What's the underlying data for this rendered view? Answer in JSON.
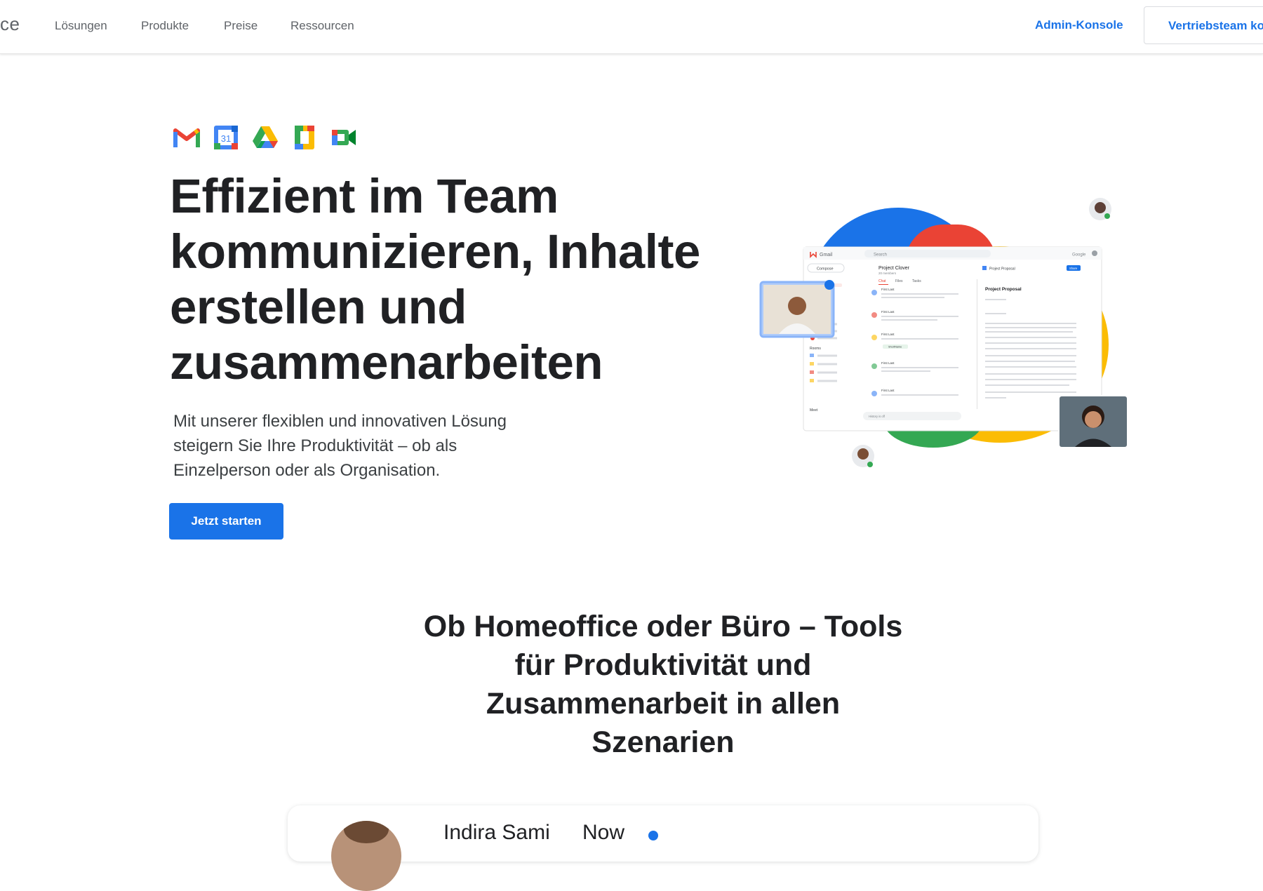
{
  "header": {
    "brand_text": "ce",
    "nav": [
      {
        "label": "Lösungen"
      },
      {
        "label": "Produkte"
      },
      {
        "label": "Preise"
      },
      {
        "label": "Ressourcen"
      }
    ],
    "admin_link": "Admin-Konsole",
    "sales_button": "Vertriebsteam ko"
  },
  "hero": {
    "app_icons": [
      "gmail-icon",
      "calendar-icon",
      "drive-icon",
      "docs-icon",
      "meet-icon"
    ],
    "calendar_day": "31",
    "title_lines": [
      "Effizient im Team",
      "kommunizieren, Inhalte",
      "erstellen und",
      "zusammenarbeiten"
    ],
    "subtitle_lines": [
      "Mit unserer flexiblen und innovativen Lösung",
      "steigern Sie Ihre Produktivität – ob als",
      "Einzelperson oder als Organisation."
    ],
    "cta_label": "Jetzt starten"
  },
  "illustration": {
    "gmail_label": "Gmail",
    "search_label": "Search",
    "google_label": "Google",
    "compose_label": "Compose",
    "chat_title": "Project Clover",
    "chat_members": "20 members",
    "chat_tabs": [
      "Chat",
      "Files",
      "Tasks"
    ],
    "chat_senders": [
      "First Last",
      "First Last",
      "First Last",
      "First Last",
      "First Last"
    ],
    "doc_tab_title": "Project Proposal",
    "doc_heading": "Project Proposal",
    "share_label": "Share",
    "rooms_label": "Rooms",
    "meet_label": "Meet",
    "history_label": "History is off",
    "file_chip": "ShortName",
    "colors": {
      "blue": "#1a73e8",
      "red": "#ea4335",
      "yellow": "#fbbc04",
      "green": "#34a853"
    }
  },
  "section2": {
    "title_lines": [
      "Ob Homeoffice oder Büro – Tools",
      "für Produktivität und",
      "Zusammenarbeit in allen",
      "Szenarien"
    ]
  },
  "chat_card": {
    "name": "Indira Sami",
    "time": "Now"
  }
}
